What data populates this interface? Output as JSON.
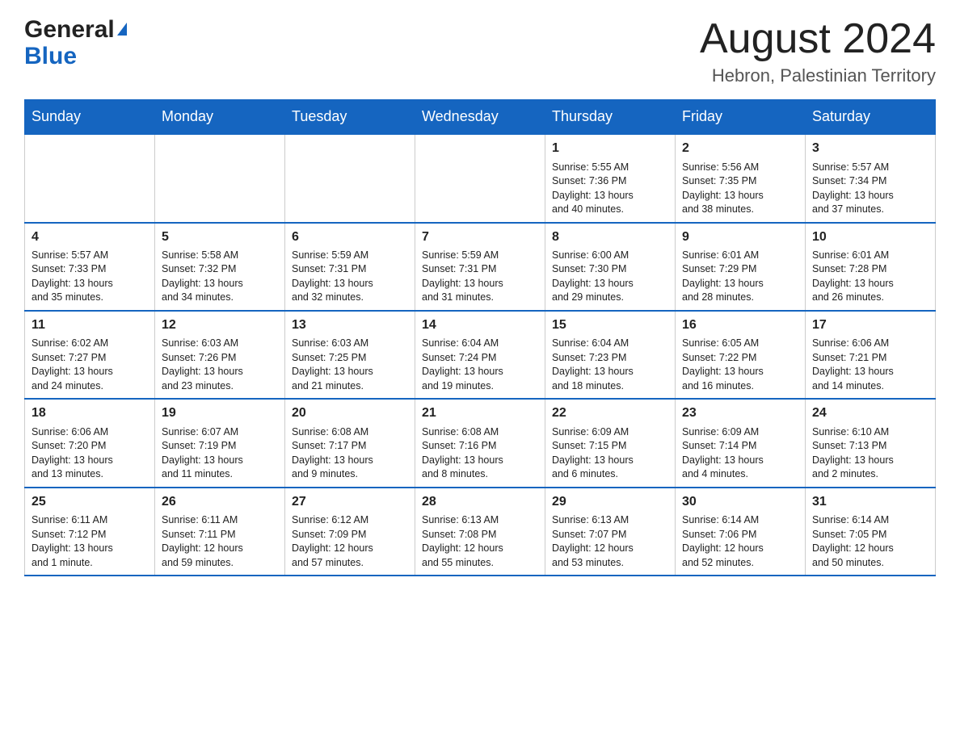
{
  "header": {
    "logo_general": "General",
    "logo_blue": "Blue",
    "month_title": "August 2024",
    "location": "Hebron, Palestinian Territory"
  },
  "weekdays": [
    "Sunday",
    "Monday",
    "Tuesday",
    "Wednesday",
    "Thursday",
    "Friday",
    "Saturday"
  ],
  "weeks": [
    [
      {
        "day": "",
        "info": ""
      },
      {
        "day": "",
        "info": ""
      },
      {
        "day": "",
        "info": ""
      },
      {
        "day": "",
        "info": ""
      },
      {
        "day": "1",
        "info": "Sunrise: 5:55 AM\nSunset: 7:36 PM\nDaylight: 13 hours\nand 40 minutes."
      },
      {
        "day": "2",
        "info": "Sunrise: 5:56 AM\nSunset: 7:35 PM\nDaylight: 13 hours\nand 38 minutes."
      },
      {
        "day": "3",
        "info": "Sunrise: 5:57 AM\nSunset: 7:34 PM\nDaylight: 13 hours\nand 37 minutes."
      }
    ],
    [
      {
        "day": "4",
        "info": "Sunrise: 5:57 AM\nSunset: 7:33 PM\nDaylight: 13 hours\nand 35 minutes."
      },
      {
        "day": "5",
        "info": "Sunrise: 5:58 AM\nSunset: 7:32 PM\nDaylight: 13 hours\nand 34 minutes."
      },
      {
        "day": "6",
        "info": "Sunrise: 5:59 AM\nSunset: 7:31 PM\nDaylight: 13 hours\nand 32 minutes."
      },
      {
        "day": "7",
        "info": "Sunrise: 5:59 AM\nSunset: 7:31 PM\nDaylight: 13 hours\nand 31 minutes."
      },
      {
        "day": "8",
        "info": "Sunrise: 6:00 AM\nSunset: 7:30 PM\nDaylight: 13 hours\nand 29 minutes."
      },
      {
        "day": "9",
        "info": "Sunrise: 6:01 AM\nSunset: 7:29 PM\nDaylight: 13 hours\nand 28 minutes."
      },
      {
        "day": "10",
        "info": "Sunrise: 6:01 AM\nSunset: 7:28 PM\nDaylight: 13 hours\nand 26 minutes."
      }
    ],
    [
      {
        "day": "11",
        "info": "Sunrise: 6:02 AM\nSunset: 7:27 PM\nDaylight: 13 hours\nand 24 minutes."
      },
      {
        "day": "12",
        "info": "Sunrise: 6:03 AM\nSunset: 7:26 PM\nDaylight: 13 hours\nand 23 minutes."
      },
      {
        "day": "13",
        "info": "Sunrise: 6:03 AM\nSunset: 7:25 PM\nDaylight: 13 hours\nand 21 minutes."
      },
      {
        "day": "14",
        "info": "Sunrise: 6:04 AM\nSunset: 7:24 PM\nDaylight: 13 hours\nand 19 minutes."
      },
      {
        "day": "15",
        "info": "Sunrise: 6:04 AM\nSunset: 7:23 PM\nDaylight: 13 hours\nand 18 minutes."
      },
      {
        "day": "16",
        "info": "Sunrise: 6:05 AM\nSunset: 7:22 PM\nDaylight: 13 hours\nand 16 minutes."
      },
      {
        "day": "17",
        "info": "Sunrise: 6:06 AM\nSunset: 7:21 PM\nDaylight: 13 hours\nand 14 minutes."
      }
    ],
    [
      {
        "day": "18",
        "info": "Sunrise: 6:06 AM\nSunset: 7:20 PM\nDaylight: 13 hours\nand 13 minutes."
      },
      {
        "day": "19",
        "info": "Sunrise: 6:07 AM\nSunset: 7:19 PM\nDaylight: 13 hours\nand 11 minutes."
      },
      {
        "day": "20",
        "info": "Sunrise: 6:08 AM\nSunset: 7:17 PM\nDaylight: 13 hours\nand 9 minutes."
      },
      {
        "day": "21",
        "info": "Sunrise: 6:08 AM\nSunset: 7:16 PM\nDaylight: 13 hours\nand 8 minutes."
      },
      {
        "day": "22",
        "info": "Sunrise: 6:09 AM\nSunset: 7:15 PM\nDaylight: 13 hours\nand 6 minutes."
      },
      {
        "day": "23",
        "info": "Sunrise: 6:09 AM\nSunset: 7:14 PM\nDaylight: 13 hours\nand 4 minutes."
      },
      {
        "day": "24",
        "info": "Sunrise: 6:10 AM\nSunset: 7:13 PM\nDaylight: 13 hours\nand 2 minutes."
      }
    ],
    [
      {
        "day": "25",
        "info": "Sunrise: 6:11 AM\nSunset: 7:12 PM\nDaylight: 13 hours\nand 1 minute."
      },
      {
        "day": "26",
        "info": "Sunrise: 6:11 AM\nSunset: 7:11 PM\nDaylight: 12 hours\nand 59 minutes."
      },
      {
        "day": "27",
        "info": "Sunrise: 6:12 AM\nSunset: 7:09 PM\nDaylight: 12 hours\nand 57 minutes."
      },
      {
        "day": "28",
        "info": "Sunrise: 6:13 AM\nSunset: 7:08 PM\nDaylight: 12 hours\nand 55 minutes."
      },
      {
        "day": "29",
        "info": "Sunrise: 6:13 AM\nSunset: 7:07 PM\nDaylight: 12 hours\nand 53 minutes."
      },
      {
        "day": "30",
        "info": "Sunrise: 6:14 AM\nSunset: 7:06 PM\nDaylight: 12 hours\nand 52 minutes."
      },
      {
        "day": "31",
        "info": "Sunrise: 6:14 AM\nSunset: 7:05 PM\nDaylight: 12 hours\nand 50 minutes."
      }
    ]
  ]
}
